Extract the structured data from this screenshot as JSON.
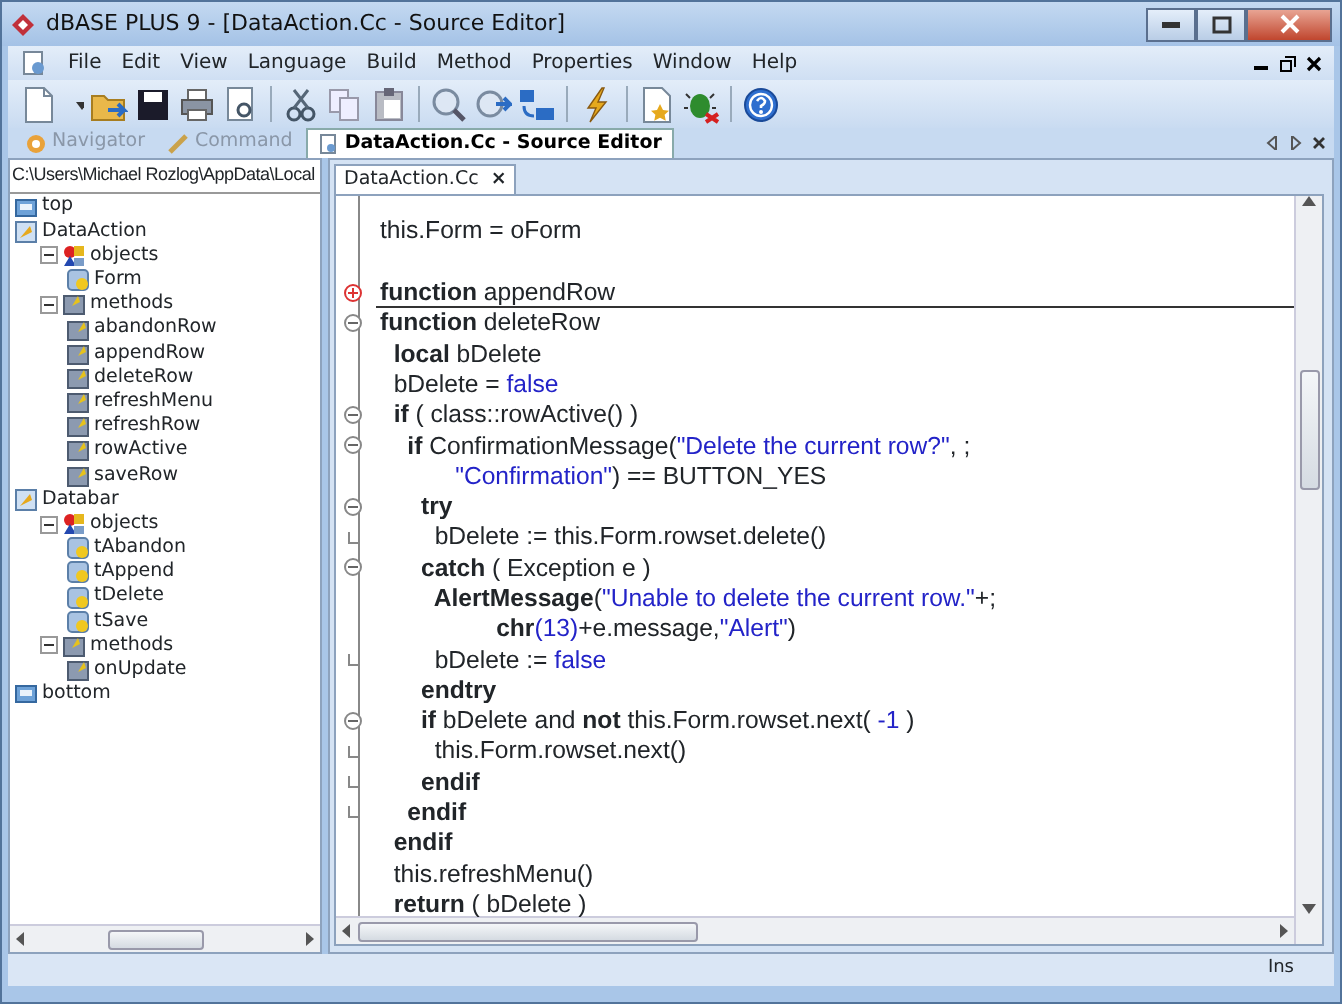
{
  "window": {
    "title": "dBASE PLUS 9 - [DataAction.Cc - Source Editor]"
  },
  "menu": [
    "File",
    "Edit",
    "View",
    "Language",
    "Build",
    "Method",
    "Properties",
    "Window",
    "Help"
  ],
  "panel_tabs": [
    {
      "label": "Navigator",
      "selected": false
    },
    {
      "label": "Command",
      "selected": false
    },
    {
      "label": "DataAction.Cc - Source Editor",
      "selected": true
    }
  ],
  "tree": {
    "path": "C:\\Users\\Michael Rozlog\\AppData\\Local",
    "nodes": [
      {
        "label": "top",
        "kind": "marker"
      },
      {
        "label": "DataAction",
        "kind": "class",
        "children": [
          {
            "label": "objects",
            "kind": "objects",
            "expanded": true,
            "children": [
              {
                "label": "Form",
                "kind": "object"
              }
            ]
          },
          {
            "label": "methods",
            "kind": "methods",
            "expanded": true,
            "children": [
              {
                "label": "abandonRow",
                "kind": "method"
              },
              {
                "label": "appendRow",
                "kind": "method"
              },
              {
                "label": "deleteRow",
                "kind": "method"
              },
              {
                "label": "refreshMenu",
                "kind": "method"
              },
              {
                "label": "refreshRow",
                "kind": "method"
              },
              {
                "label": "rowActive",
                "kind": "method"
              },
              {
                "label": "saveRow",
                "kind": "method"
              }
            ]
          }
        ]
      },
      {
        "label": "Databar",
        "kind": "class",
        "children": [
          {
            "label": "objects",
            "kind": "objects",
            "expanded": true,
            "children": [
              {
                "label": "tAbandon",
                "kind": "object"
              },
              {
                "label": "tAppend",
                "kind": "object"
              },
              {
                "label": "tDelete",
                "kind": "object"
              },
              {
                "label": "tSave",
                "kind": "object"
              }
            ]
          },
          {
            "label": "methods",
            "kind": "methods",
            "expanded": true,
            "children": [
              {
                "label": "onUpdate",
                "kind": "method"
              }
            ]
          }
        ]
      },
      {
        "label": "bottom",
        "kind": "marker"
      }
    ]
  },
  "editor": {
    "tab": "DataAction.Cc",
    "close": "×",
    "lines": [
      {
        "tokens": [
          {
            "kind": "plain",
            "text": "this.Form = oForm"
          }
        ]
      },
      {
        "blank": true
      },
      {
        "foldable": true,
        "collapsed": true,
        "tokens": [
          {
            "kind": "kw",
            "text": "function"
          },
          {
            "kind": "plain",
            "text": " appendRow"
          }
        ]
      },
      {
        "foldable": true,
        "collapsed": false,
        "tokens": [
          {
            "kind": "kw",
            "text": "function"
          },
          {
            "kind": "plain",
            "text": " deleteRow"
          }
        ]
      },
      {
        "tokens": [
          {
            "kind": "kw",
            "text": "  local"
          },
          {
            "kind": "plain",
            "text": " bDelete"
          }
        ]
      },
      {
        "tokens": [
          {
            "kind": "plain",
            "text": "  bDelete = "
          },
          {
            "kind": "str",
            "text": "false"
          }
        ]
      },
      {
        "foldable": true,
        "collapsed": false,
        "tokens": [
          {
            "kind": "kw",
            "text": "  if"
          },
          {
            "kind": "plain",
            "text": " ( class::rowActive() )"
          }
        ]
      },
      {
        "foldable": true,
        "collapsed": false,
        "tokens": [
          {
            "kind": "kw",
            "text": "    if"
          },
          {
            "kind": "plain",
            "text": " ConfirmationMessage("
          },
          {
            "kind": "str",
            "text": "\"Delete the current row?\""
          },
          {
            "kind": "plain",
            "text": ", ;"
          }
        ]
      },
      {
        "tokens": [
          {
            "kind": "str",
            "text": "           \"Confirmation\""
          },
          {
            "kind": "plain",
            "text": ") == BUTTON_YES"
          }
        ]
      },
      {
        "foldable": true,
        "collapsed": false,
        "tokens": [
          {
            "kind": "kw",
            "text": "      try"
          }
        ]
      },
      {
        "fold_end": true,
        "tokens": [
          {
            "kind": "plain",
            "text": "        bDelete := this.Form.rowset.delete()"
          }
        ]
      },
      {
        "foldable": true,
        "collapsed": false,
        "tokens": [
          {
            "kind": "kw",
            "text": "      catch"
          },
          {
            "kind": "plain",
            "text": " ( Exception e )"
          }
        ]
      },
      {
        "tokens": [
          {
            "kind": "kw",
            "text": "        AlertMessage"
          },
          {
            "kind": "plain",
            "text": "("
          },
          {
            "kind": "str",
            "text": "\"Unable to delete the current row.\""
          },
          {
            "kind": "plain",
            "text": "+;"
          }
        ]
      },
      {
        "tokens": [
          {
            "kind": "kw",
            "text": "                 chr"
          },
          {
            "kind": "str",
            "text": "(13)"
          },
          {
            "kind": "plain",
            "text": "+e.message,"
          },
          {
            "kind": "str",
            "text": "\"Alert\""
          },
          {
            "kind": "plain",
            "text": ")"
          }
        ]
      },
      {
        "fold_end": true,
        "tokens": [
          {
            "kind": "plain",
            "text": "        bDelete := "
          },
          {
            "kind": "str",
            "text": "false"
          }
        ]
      },
      {
        "tokens": [
          {
            "kind": "kw",
            "text": "      endtry"
          }
        ]
      },
      {
        "foldable": true,
        "collapsed": false,
        "tokens": [
          {
            "kind": "kw",
            "text": "      if"
          },
          {
            "kind": "plain",
            "text": " bDelete and "
          },
          {
            "kind": "kw",
            "text": "not"
          },
          {
            "kind": "plain",
            "text": " this.Form.rowset.next( "
          },
          {
            "kind": "str",
            "text": "-1"
          },
          {
            "kind": "plain",
            "text": " )"
          }
        ]
      },
      {
        "fold_end": true,
        "tokens": [
          {
            "kind": "plain",
            "text": "        this.Form.rowset.next()"
          }
        ]
      },
      {
        "fold_end": true,
        "tokens": [
          {
            "kind": "kw",
            "text": "      endif"
          }
        ]
      },
      {
        "fold_end": true,
        "tokens": [
          {
            "kind": "kw",
            "text": "    endif"
          }
        ]
      },
      {
        "tokens": [
          {
            "kind": "kw",
            "text": "  endif"
          }
        ]
      },
      {
        "tokens": [
          {
            "kind": "plain",
            "text": "  this.refreshMenu()"
          }
        ]
      },
      {
        "tokens": [
          {
            "kind": "kw",
            "text": "  return"
          },
          {
            "kind": "plain",
            "text": " ( bDelete )"
          }
        ]
      }
    ]
  },
  "status_bar": {
    "mode": "Ins"
  }
}
